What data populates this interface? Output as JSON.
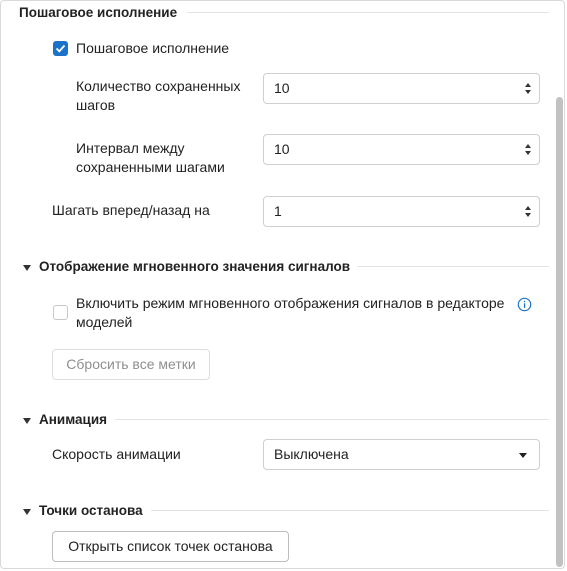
{
  "step_section": {
    "title": "Пошаговое исполнение",
    "enable_label": "Пошаговое исполнение",
    "saved_steps_label_l1": "Количество сохраненных",
    "saved_steps_label_l2": "шагов",
    "saved_steps_value": "10",
    "interval_label_l1": "Интервал между",
    "interval_label_l2": "сохраненными шагами",
    "interval_value": "10",
    "step_label": "Шагать вперед/назад на",
    "step_value": "1"
  },
  "signal_section": {
    "title": "Отображение мгновенного значения сигналов",
    "enable_label_l1": "Включить режим мгновенного отображения сигналов в редакторе",
    "enable_label_l2": "моделей",
    "reset_button": "Сбросить все метки"
  },
  "animation_section": {
    "title": "Анимация",
    "speed_label": "Скорость анимации",
    "speed_value": "Выключена"
  },
  "breakpoints_section": {
    "title": "Точки останова",
    "open_button": "Открыть список точек останова"
  },
  "colors": {
    "accent": "#1a73c8",
    "border": "#cfcfcf",
    "scrollbar": "#c2c2c2"
  }
}
